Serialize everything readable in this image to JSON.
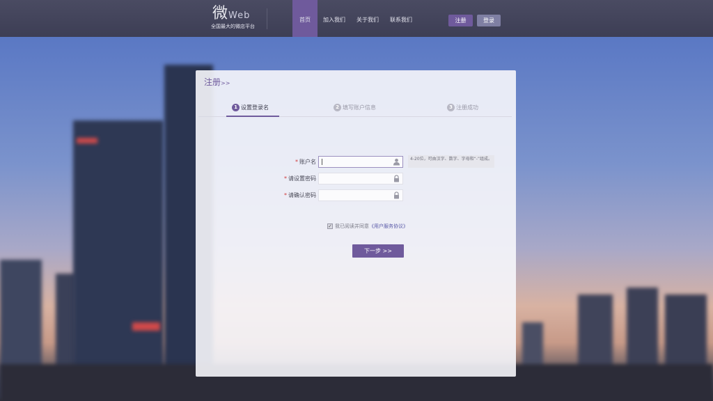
{
  "header": {
    "logo_mark": "微",
    "logo_suffix": "Web",
    "tagline": "全国最大的微店平台",
    "nav": [
      {
        "label": "首页",
        "active": true
      },
      {
        "label": "加入我们",
        "active": false
      },
      {
        "label": "关于我们",
        "active": false
      },
      {
        "label": "联系我们",
        "active": false
      }
    ],
    "register_label": "注册",
    "login_label": "登录"
  },
  "card": {
    "title": "注册",
    "title_suffix": ">>",
    "steps": [
      {
        "num": "1",
        "label": "设置登录名",
        "active": true
      },
      {
        "num": "2",
        "label": "填写账户信息",
        "active": false
      },
      {
        "num": "3",
        "label": "注册成功",
        "active": false
      }
    ],
    "fields": {
      "account": {
        "label": "账户名",
        "value": "",
        "hint": "4-20位，可由汉字、数字、字母和“-”组成。",
        "icon": "user-icon"
      },
      "password": {
        "label": "请设置密码",
        "value": "",
        "icon": "lock-icon"
      },
      "confirm": {
        "label": "请确认密码",
        "value": "",
        "icon": "lock-icon"
      }
    },
    "required_mark": "*",
    "agree_text": "我已阅读并同意",
    "agree_link": "《用户服务协议》",
    "agree_checked": true,
    "next_label": "下一步 >>"
  },
  "colors": {
    "accent": "#6f5a9c",
    "header_bg": "#3d3e55",
    "login_btn": "#7f7fa3",
    "required": "#d03a3a"
  }
}
